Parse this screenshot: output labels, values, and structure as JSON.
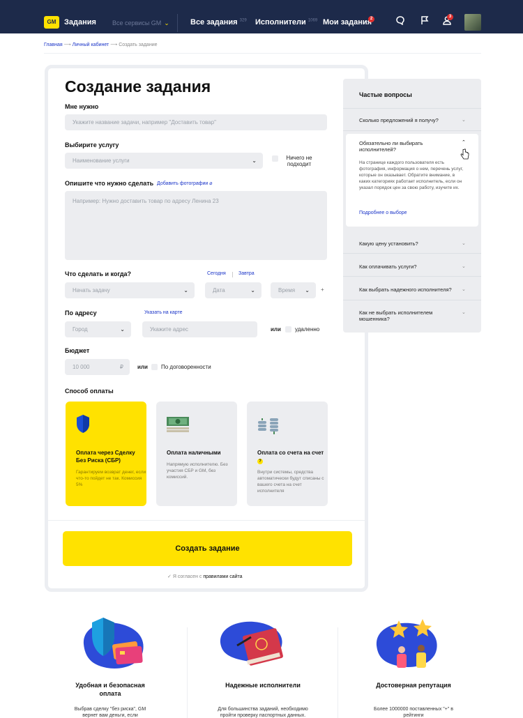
{
  "header": {
    "logo": "GM",
    "title": "Задания",
    "services": "Все сервисы GM",
    "nav": [
      {
        "label": "Все задания",
        "count": "329"
      },
      {
        "label": "Исполнители",
        "count": "1069"
      },
      {
        "label": "Мои задания",
        "badge": "2"
      }
    ],
    "profile_badge": "3"
  },
  "breadcrumb": {
    "home": "Главная",
    "cabinet": "Личный кабинет",
    "current": "Создать задание"
  },
  "form": {
    "title": "Создание задания",
    "need_label": "Мне нужно",
    "need_placeholder": "Укажите название задачи, например \"Доставить товар\"",
    "service_label": "Выбирите услугу",
    "service_placeholder": "Наименование услуги",
    "nothing_fits": "Ничего не подходит",
    "describe_label": "Опишите что нужно сделать",
    "add_photos": "Добавить фотографии",
    "describe_placeholder": "Например: Нужно доставить товар по адресу Ленина 23",
    "when_label": "Что сделать и когда?",
    "today": "Сегодня",
    "tomorrow": "Завтра",
    "start_task": "Начать задачу",
    "date": "Дата",
    "time": "Время",
    "address_label": "По адресу",
    "on_map": "Указать на карте",
    "city": "Город",
    "address_placeholder": "Укажите адрес",
    "or": "или",
    "remote": "удаленно",
    "budget_label": "Бюджет",
    "budget_placeholder": "10 000",
    "currency": "₽",
    "negotiable": "По договоренности",
    "payment_label": "Способ оплаты",
    "payments": [
      {
        "title": "Оплата через Сделку Без Риска (СБР)",
        "desc": "Гарантируем возврат денег, если что-то пойдет не так. Комиссия 5%"
      },
      {
        "title": "Оплата наличными",
        "desc": "Напрямую исполнителю. Без участия СБР и GM, без комиссий."
      },
      {
        "title": "Оплата со счета на счет",
        "desc": "Внутри системы, средства автоматически будут списаны с вашего счета на счет исполнителя"
      }
    ],
    "submit": "Создать задание",
    "agree_text": "Я согласен с",
    "agree_link": "правилами сайта"
  },
  "faq": {
    "title": "Частые вопросы",
    "items": [
      {
        "q": "Сколько предложений я получу?"
      },
      {
        "q": "Обязательно ли выбирать исполнителей?",
        "answer": "На странице каждого пользователя есть фотография, информация о нем, перечень услуг, которые он оказывает. Обратите внимание, в каких категориях работает исполнитель, если он указал порядок цен за свою работу, изучите их.",
        "link": "Подробнее о выборе"
      },
      {
        "q": "Какую цену установить?"
      },
      {
        "q": "Как оплачивать услуги?"
      },
      {
        "q": "Как выбрать надежного исполнителя?"
      },
      {
        "q": "Как не выбрать исполнителем мошенника?"
      }
    ]
  },
  "features": [
    {
      "title": "Удобная и безопасная оплата",
      "desc": "Выбрав сделку \"без риска\", GM вернет вам деньги, если"
    },
    {
      "title": "Надежные исполнители",
      "desc": "Для большинства заданий, необходимо пройти проверку паспортных данных."
    },
    {
      "title": "Достоверная репутация",
      "desc": "Более 1000000 поставленных \"+\" в рейтинги"
    }
  ],
  "colors": {
    "navy": "#1d2a4a",
    "accent": "#ffe200",
    "link": "#1a34c8"
  }
}
